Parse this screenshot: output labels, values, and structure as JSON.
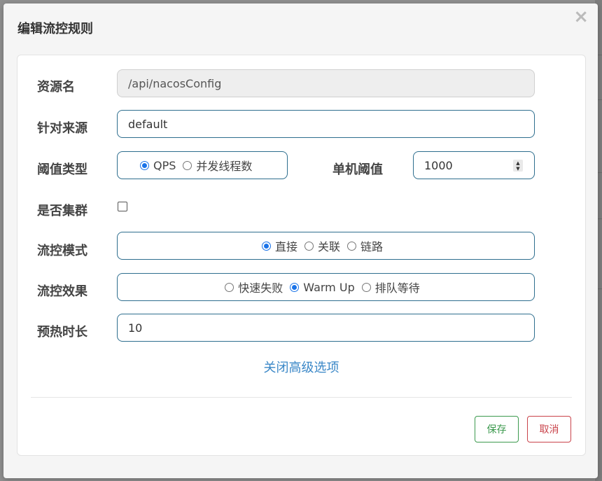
{
  "dialog": {
    "title": "编辑流控规则",
    "close_glyph": "×"
  },
  "form": {
    "resource": {
      "label": "资源名",
      "value": "/api/nacosConfig"
    },
    "limit_app": {
      "label": "针对来源",
      "value": "default"
    },
    "grade": {
      "label": "阈值类型",
      "options": [
        {
          "label": "QPS",
          "selected": true
        },
        {
          "label": "并发线程数",
          "selected": false
        }
      ]
    },
    "threshold": {
      "label": "单机阈值",
      "value": "1000"
    },
    "cluster": {
      "label": "是否集群",
      "checked": false
    },
    "strategy": {
      "label": "流控模式",
      "options": [
        {
          "label": "直接",
          "selected": true
        },
        {
          "label": "关联",
          "selected": false
        },
        {
          "label": "链路",
          "selected": false
        }
      ]
    },
    "control_behavior": {
      "label": "流控效果",
      "options": [
        {
          "label": "快速失败",
          "selected": false
        },
        {
          "label": "Warm Up",
          "selected": true
        },
        {
          "label": "排队等待",
          "selected": false
        }
      ]
    },
    "warmup": {
      "label": "预热时长",
      "value": "10"
    },
    "advanced_link": "关闭高级选项"
  },
  "buttons": {
    "save": "保存",
    "cancel": "取消"
  },
  "colors": {
    "accent": "#1a73e8",
    "field_border": "#2e6e8e",
    "save": "#3c9a4e",
    "cancel": "#c9434a",
    "link": "#3a87c7"
  }
}
